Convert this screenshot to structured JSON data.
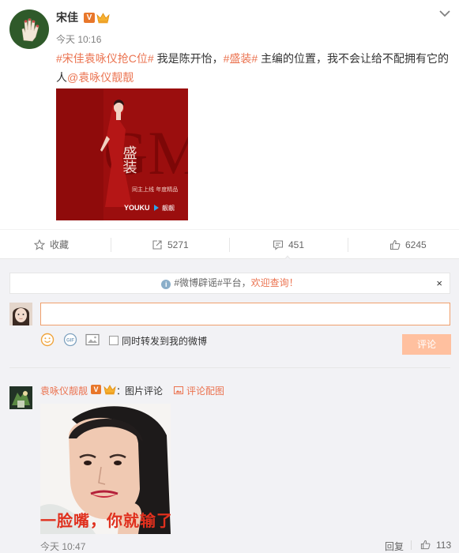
{
  "post": {
    "author": "宋佳",
    "verified_badge": "V",
    "time": "今天 10:16",
    "text_parts": [
      {
        "text": "#宋佳袁咏仪抢C位#",
        "type": "topic"
      },
      {
        "text": " 我是陈开怡，",
        "type": "plain"
      },
      {
        "text": "#盛装#",
        "type": "topic"
      },
      {
        "text": " 主编的位置，我不会让给不配拥有它的人",
        "type": "plain"
      },
      {
        "text": "@袁咏仪靓靓",
        "type": "topic"
      }
    ],
    "image_icons": {
      "avatar": "hand-icon",
      "crown": "vip-crown-icon",
      "menu": "chevron-down-icon"
    },
    "photo": {
      "poster_letters": "GM",
      "poster_title": "盛装",
      "poster_line1": "同主上线 年度精品",
      "poster_brand_youku": "YOUKU",
      "poster_brand_play": "靓靓"
    }
  },
  "actions": [
    {
      "name": "favorite",
      "label": "收藏",
      "icon": "star-icon"
    },
    {
      "name": "repost",
      "label": "5271",
      "icon": "repost-icon"
    },
    {
      "name": "comment",
      "label": "451",
      "icon": "comment-icon"
    },
    {
      "name": "like",
      "label": "6245",
      "icon": "thumbs-up-icon"
    }
  ],
  "comment_box": {
    "rumor_prefix": "#微博辟谣#平台，",
    "rumor_link": "欢迎查询！",
    "rumor_icon": "i",
    "close": "×",
    "input_value": "",
    "input_placeholder": "",
    "repost_checkbox_label": "同时转发到我的微博",
    "submit_label": "评论",
    "tool_icons": [
      "emoji-icon",
      "gif-icon",
      "image-icon"
    ]
  },
  "comment": {
    "author": "袁咏仪靓靓",
    "verified_badge": "V",
    "colon": "：",
    "text": "图片评论",
    "pic_link": "评论配图",
    "caption": "一脸嘴，你就输了",
    "time": "今天 10:47",
    "reply_label": "回复",
    "likes": "113"
  },
  "colors": {
    "accent": "#eb7350",
    "photo_red": "#9b0e0e",
    "submit_disabled": "#ffc09f"
  }
}
